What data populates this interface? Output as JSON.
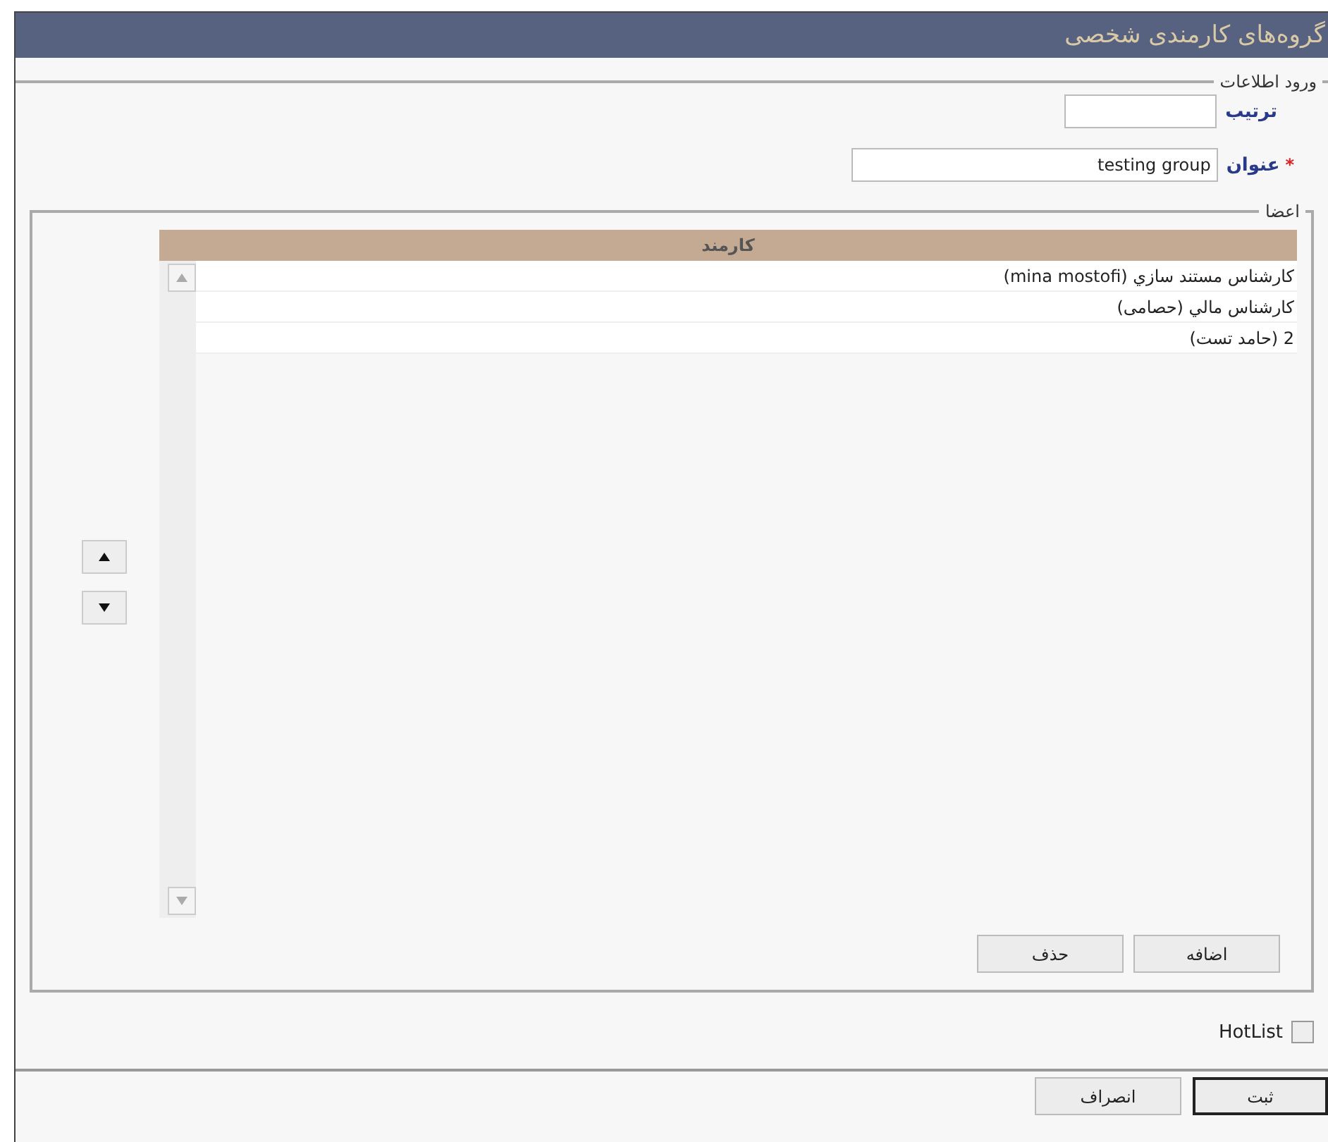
{
  "window": {
    "title": "گروه‌های کارمندی شخصی"
  },
  "info_section": {
    "legend": "ورود اطلاعات",
    "fields": [
      {
        "label": "ترتیب"
      },
      {
        "label": "عنوان",
        "value": "testing group",
        "required_mark": "*"
      }
    ]
  },
  "members": {
    "legend": "اعضا",
    "column": "كارمند",
    "rows": [
      {
        "text": "كارشناس مستند سازي (mina mostofi)"
      },
      {
        "text": "كارشناس مالي (حصامی)"
      },
      {
        "text": "2 (حامد تست)"
      }
    ],
    "buttons": [
      "اضافه",
      "حذف"
    ]
  },
  "hotlist": {
    "label": "HotList",
    "checked": false
  },
  "footer": {
    "buttons": [
      {
        "label": "ثبت",
        "default": true
      },
      {
        "label": "انصراف",
        "default": false
      }
    ]
  }
}
